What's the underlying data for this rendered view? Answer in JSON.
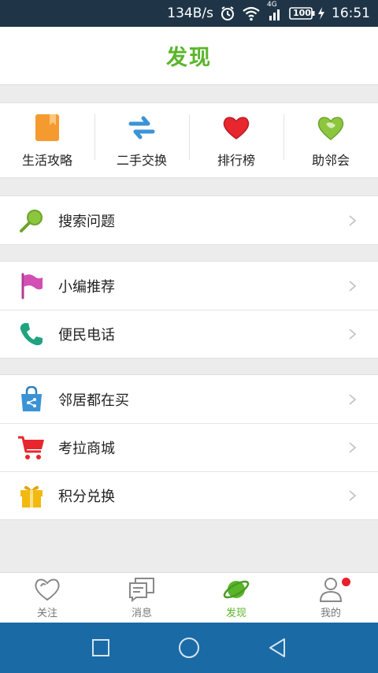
{
  "status_bar": {
    "speed": "134B/s",
    "network": "4G",
    "battery": "100",
    "time": "16:51"
  },
  "header": {
    "title": "发现"
  },
  "quick_items": [
    {
      "label": "生活攻略",
      "icon": "book-icon",
      "color": "#f59a2e"
    },
    {
      "label": "二手交换",
      "icon": "swap-arrows-icon",
      "color": "#3b93d6"
    },
    {
      "label": "排行榜",
      "icon": "heart-icon",
      "color": "#e8262e"
    },
    {
      "label": "助邻会",
      "icon": "leaf-heart-icon",
      "color": "#8cc63e"
    }
  ],
  "groups": [
    {
      "items": [
        {
          "label": "搜索问题",
          "icon": "search-icon",
          "color": "#8cc63e"
        }
      ]
    },
    {
      "items": [
        {
          "label": "小编推荐",
          "icon": "flag-icon",
          "color": "#d24fb4"
        },
        {
          "label": "便民电话",
          "icon": "phone-icon",
          "color": "#1fa380"
        }
      ]
    },
    {
      "items": [
        {
          "label": "邻居都在买",
          "icon": "shopping-bag-icon",
          "color": "#3b93d6"
        },
        {
          "label": "考拉商城",
          "icon": "shopping-cart-icon",
          "color": "#e8262e"
        },
        {
          "label": "积分兑换",
          "icon": "gift-icon",
          "color": "#f2b90f"
        }
      ]
    }
  ],
  "tabs": [
    {
      "label": "关注",
      "icon": "heart-outline-icon",
      "active": false
    },
    {
      "label": "消息",
      "icon": "message-icon",
      "active": false
    },
    {
      "label": "发现",
      "icon": "planet-icon",
      "active": true
    },
    {
      "label": "我的",
      "icon": "user-icon",
      "active": false,
      "badge": true
    }
  ],
  "colors": {
    "accent": "#5ab52a",
    "status_bar": "#1f3547",
    "nav_bar": "#1a6aa6",
    "badge": "#e8202a"
  }
}
